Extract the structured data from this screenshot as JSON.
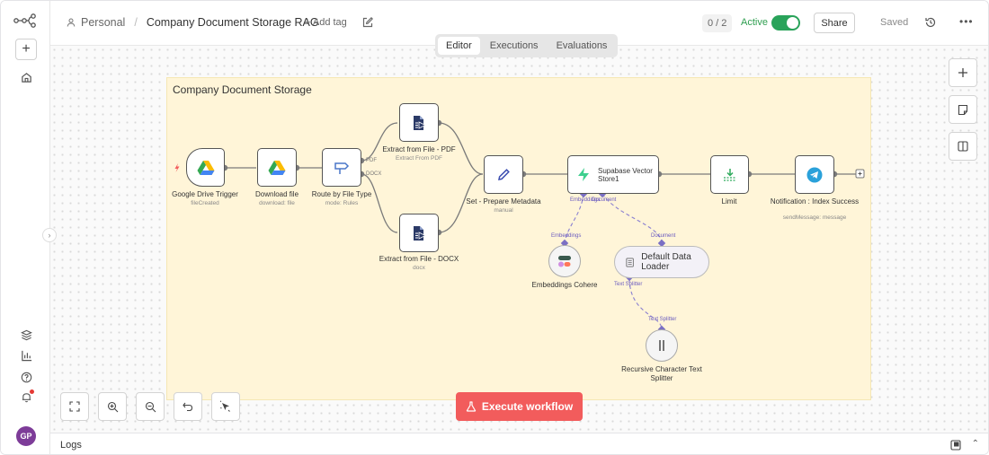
{
  "header": {
    "breadcrumb_owner": "Personal",
    "workflow_title": "Company Document Storage RAG",
    "add_tag": "+ Add tag",
    "counter": "0 / 2",
    "active_label": "Active",
    "share_label": "Share",
    "saved_label": "Saved"
  },
  "tabs": [
    {
      "label": "Editor",
      "active": true
    },
    {
      "label": "Executions",
      "active": false
    },
    {
      "label": "Evaluations",
      "active": false
    }
  ],
  "sticky": {
    "title": "Company Document Storage"
  },
  "nodes": {
    "gdrive_trigger": {
      "label": "Google Drive Trigger",
      "sub": "fileCreated"
    },
    "download_file": {
      "label": "Download file",
      "sub": "download: file"
    },
    "route": {
      "label": "Route by File Type",
      "sub": "mode: Rules",
      "out1": "PDF",
      "out2": "DOCX"
    },
    "extract_pdf": {
      "label": "Extract from File - PDF",
      "sub": "Extract From PDF"
    },
    "extract_docx": {
      "label": "Extract from File - DOCX",
      "sub": "docx"
    },
    "set_metadata": {
      "label": "Set - Prepare Metadata",
      "sub": "manual"
    },
    "supabase": {
      "label": "Supabase Vector Store1",
      "port1": "Embeddings",
      "port2": "Document"
    },
    "limit": {
      "label": "Limit"
    },
    "notify": {
      "label": "Notification : Index Success",
      "sub": "sendMessage: message"
    },
    "embeddings": {
      "label": "Embeddings Cohere",
      "port": "Embeddings"
    },
    "loader": {
      "label": "Default Data Loader",
      "port_in": "Document",
      "port_out": "Text Splitter"
    },
    "splitter": {
      "label": "Recursive Character Text Splitter",
      "port": "Text Splitter"
    }
  },
  "execute_button": "Execute workflow",
  "logs": {
    "label": "Logs"
  },
  "user": {
    "initials": "GP"
  },
  "colors": {
    "accent": "#f25c5c",
    "active_green": "#29a35a",
    "sticky_bg": "#fff5d8",
    "port_purple": "#6a5bbf"
  }
}
